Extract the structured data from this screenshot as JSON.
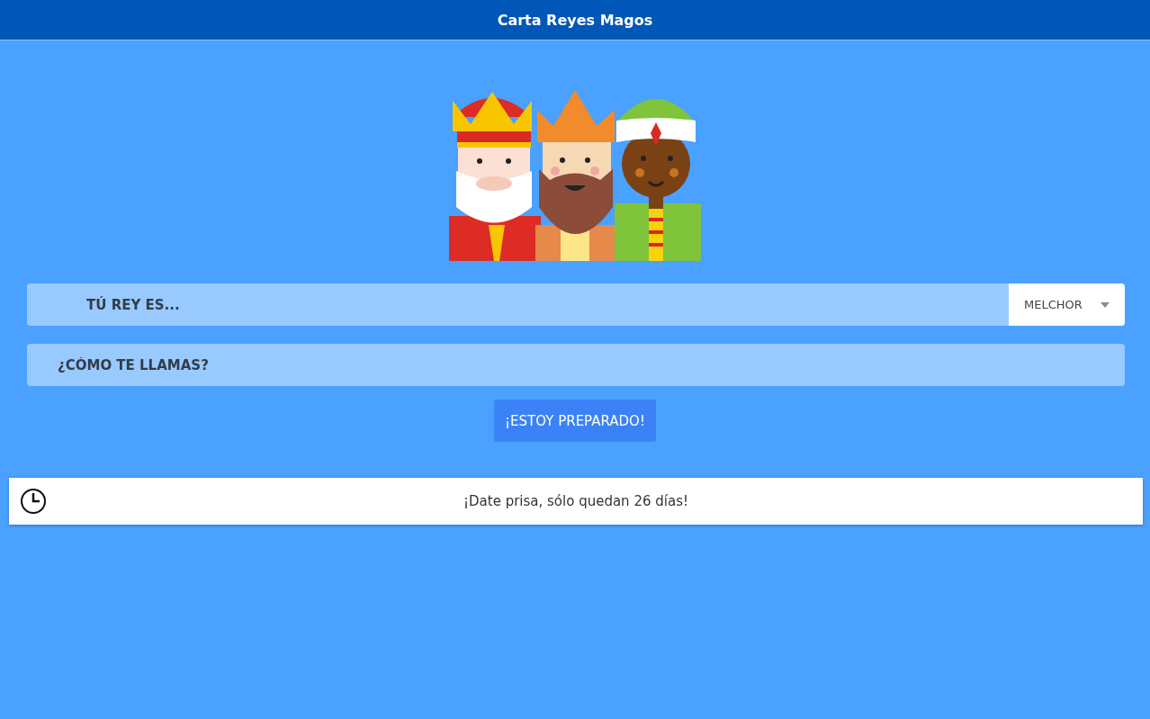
{
  "header": {
    "title": "Carta Reyes Magos"
  },
  "king_select": {
    "label": "TÚ REY ES...",
    "value": "MELCHOR"
  },
  "name_field": {
    "placeholder": "¿CÓMO TE LLAMAS?"
  },
  "submit_button": {
    "label": "¡ESTOY PREPARADO!"
  },
  "countdown": {
    "message": "¡Date prisa, sólo quedan 26 días!"
  }
}
